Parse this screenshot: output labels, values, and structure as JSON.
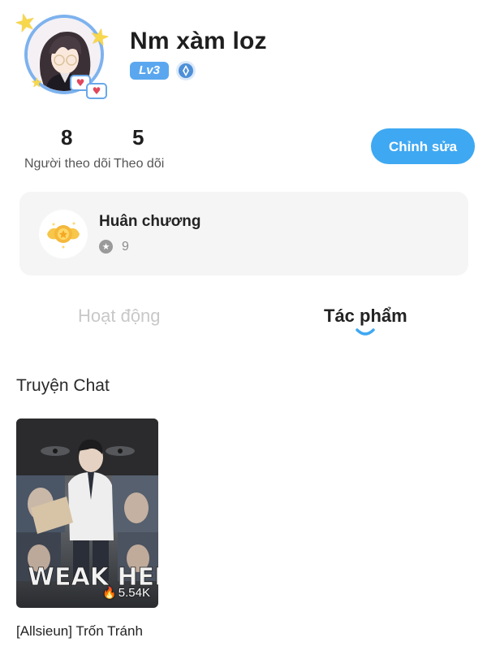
{
  "profile": {
    "username": "Nm xàm loz",
    "level": "Lv3",
    "verified_icon": "verify-badge-icon"
  },
  "stats": {
    "followers_count": "8",
    "followers_label": "Người theo dõi",
    "following_count": "5",
    "following_label": "Theo dõi"
  },
  "actions": {
    "edit_label": "Chỉnh sửa"
  },
  "medal": {
    "title": "Huân chương",
    "count": "9"
  },
  "tabs": [
    {
      "label": "Hoạt động",
      "active": false
    },
    {
      "label": "Tác phẩm",
      "active": true
    }
  ],
  "section": {
    "title": "Truyện Chat"
  },
  "stories": [
    {
      "title": "[Allsieun] Trốn Tránh",
      "views": "5.54K",
      "cover_text": "WEAK HERO"
    }
  ],
  "colors": {
    "accent": "#3fa8f2",
    "level_badge": "#5aa7ef",
    "card_bg": "#f5f5f5",
    "avatar_ring": "#7db2ee"
  }
}
